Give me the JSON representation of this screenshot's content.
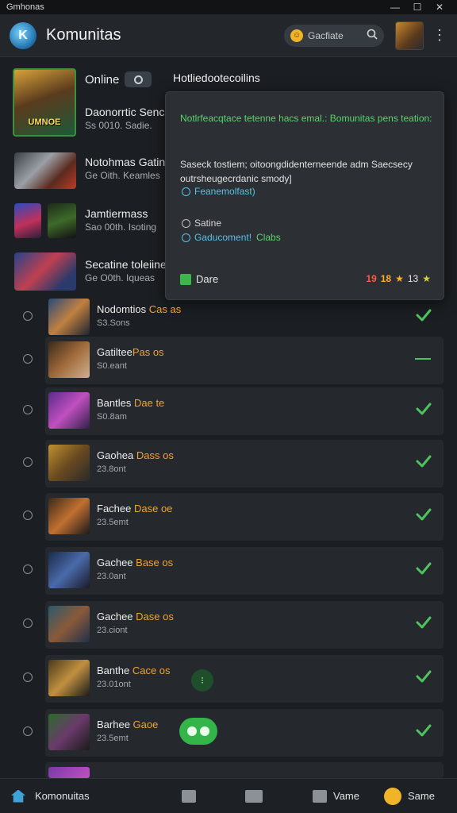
{
  "window": {
    "title": "Gmhonas",
    "minimize": "—",
    "maximize": "☐",
    "close": "✕"
  },
  "header": {
    "logo_text": "K",
    "title": "Komunitas",
    "search_label": "Gacfiate",
    "search_icon": "magnifier",
    "menu_icon": "⋮"
  },
  "featured": [
    {
      "title": "Online",
      "big_word": "UMNOE"
    },
    {
      "title": "Daonorrtic Sencle",
      "sub": "Ss 0010. Sadie."
    },
    {
      "title": "Notohmas Gatine",
      "sub": "Ge Oith. Keamles"
    },
    {
      "title": "Jamtiermass",
      "sub": "Sao 00th. Isoting"
    },
    {
      "title": "Secatine toleiine",
      "sub": "Ge O0th. Iqueas"
    }
  ],
  "panel": {
    "heading": "Hotliedootecoilins",
    "green_message": "Notlrfeacqtace tetenne hacs emal.: Bomunitas pens teation:",
    "body_message": "Saseck tostiem; oitoongdidenterneende adm Saecsecy outrsheugecrdanic smody]",
    "link_label": "Feanemolfast)",
    "setting_label": "Satine",
    "status_label": "Gaducoment!",
    "status_value": "Clabs",
    "footer_label": "Dare",
    "rating_a": "19",
    "rating_b": "18",
    "rating_c": "13",
    "star": "★"
  },
  "rows": [
    {
      "name": "Nodomtios ",
      "tag": "Cas as",
      "time": "S3.Sons"
    },
    {
      "name": "Gatiltee",
      "tag": "Pas os",
      "time": "S0.eant"
    },
    {
      "name": "Bantles ",
      "tag": "Dae te",
      "time": "S0.8am"
    },
    {
      "name": "Gaohea ",
      "tag": "Dass os",
      "time": "23.8ont"
    },
    {
      "name": "Fachee ",
      "tag": "Dase oe",
      "time": "23.5emt"
    },
    {
      "name": "Gachee ",
      "tag": "Base os",
      "time": "23.0ant"
    },
    {
      "name": "Gachee ",
      "tag": "Dase os",
      "time": "23.ciont"
    },
    {
      "name": "Banthe ",
      "tag": "Cace os",
      "time": "23.01ont"
    },
    {
      "name": "Barhee ",
      "tag": "Gaoe",
      "time": "23.5emt"
    }
  ],
  "bottom_nav": {
    "community": "Komonuitas",
    "games": "Vame",
    "profile": "Same"
  },
  "colors": {
    "accent_green": "#57d46a",
    "accent_orange": "#f0a236",
    "accent_blue": "#56c1e6"
  }
}
